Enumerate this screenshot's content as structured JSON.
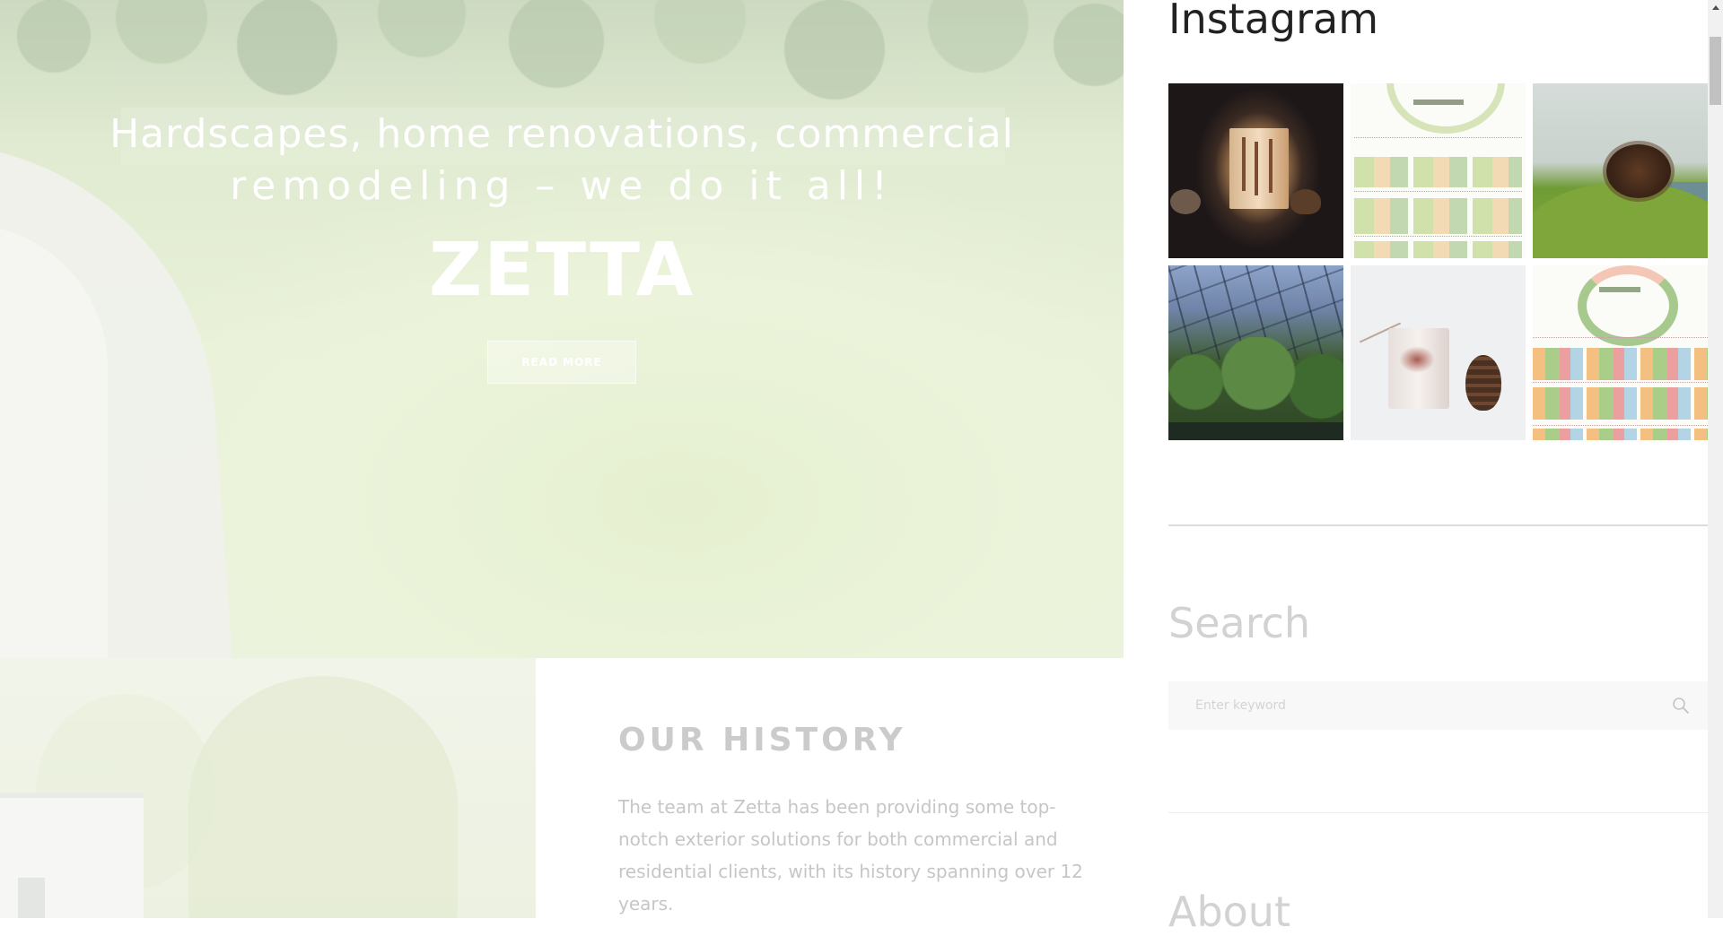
{
  "hero": {
    "heading_line1": "Hardscapes, home renovations, commercial",
    "heading_line2": "remodeling – we do it all!",
    "title": "ZETTA",
    "button_label": "READ MORE"
  },
  "history": {
    "heading": "OUR HISTORY",
    "body": "The team at Zetta has been providing some top-notch exterior solutions for both commercial and residential clients, with its history spanning over 12 years."
  },
  "sidebar": {
    "instagram_title": "Instagram",
    "instagram_images": [
      "candle-lantern-photo",
      "garden-stickers-photo",
      "hedgehog-on-moss-photo",
      "greenhouse-photo",
      "stone-cup-pinecone-photo",
      "floral-tape-photo"
    ],
    "search_title": "Search",
    "search_placeholder": "Enter keyword",
    "about_title": "About"
  },
  "icons": {
    "search": "search-icon",
    "scroll_up": "arrow-up-icon"
  },
  "colors": {
    "hero_text": "#ffffff",
    "widget_title_dark": "#222222",
    "widget_title_faded": "#d2d2d2",
    "history_text": "#c6c6c6"
  }
}
